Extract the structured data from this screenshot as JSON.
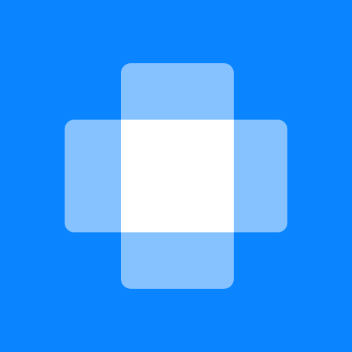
{
  "app_icon": {
    "icon": "medical-cross-icon",
    "colors": {
      "background": "#0a84ff",
      "cross_overlay": "rgba(255,255,255,0.5)",
      "center": "#ffffff"
    }
  }
}
